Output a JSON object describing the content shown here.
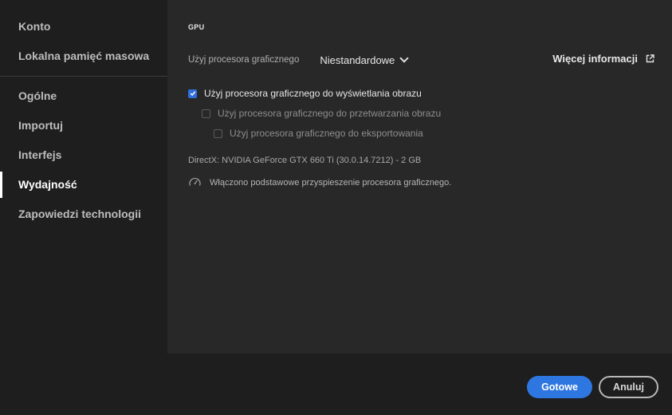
{
  "sidebar": {
    "group1": [
      {
        "label": "Konto"
      },
      {
        "label": "Lokalna pamięć masowa"
      }
    ],
    "group2": [
      {
        "label": "Ogólne"
      },
      {
        "label": "Importuj"
      },
      {
        "label": "Interfejs"
      },
      {
        "label": "Wydajność",
        "active": true
      },
      {
        "label": "Zapowiedzi technologii"
      }
    ]
  },
  "content": {
    "section_title": "GPU",
    "gpu_label": "Użyj procesora graficznego",
    "gpu_dropdown_value": "Niestandardowe",
    "more_info": "Więcej informacji",
    "options": [
      {
        "label": "Użyj procesora graficznego do wyświetlania obrazu",
        "checked": true
      },
      {
        "label": "Użyj procesora graficznego do przetwarzania obrazu",
        "checked": false
      },
      {
        "label": "Użyj procesora graficznego do eksportowania",
        "checked": false
      }
    ],
    "directx_info": "DirectX: NVIDIA GeForce GTX 660 Ti (30.0.14.7212) - 2 GB",
    "acceleration_status": "Włączono podstawowe przyspieszenie procesora graficznego."
  },
  "footer": {
    "done_label": "Gotowe",
    "cancel_label": "Anuluj"
  },
  "colors": {
    "accent": "#2e76e0",
    "background": "#1e1e1e",
    "panel": "#282828"
  },
  "icons": {
    "dropdown": "chevron-down-icon",
    "more_info": "external-link-icon",
    "acceleration": "gauge-icon",
    "checkbox_checked": "checkmark-icon"
  }
}
